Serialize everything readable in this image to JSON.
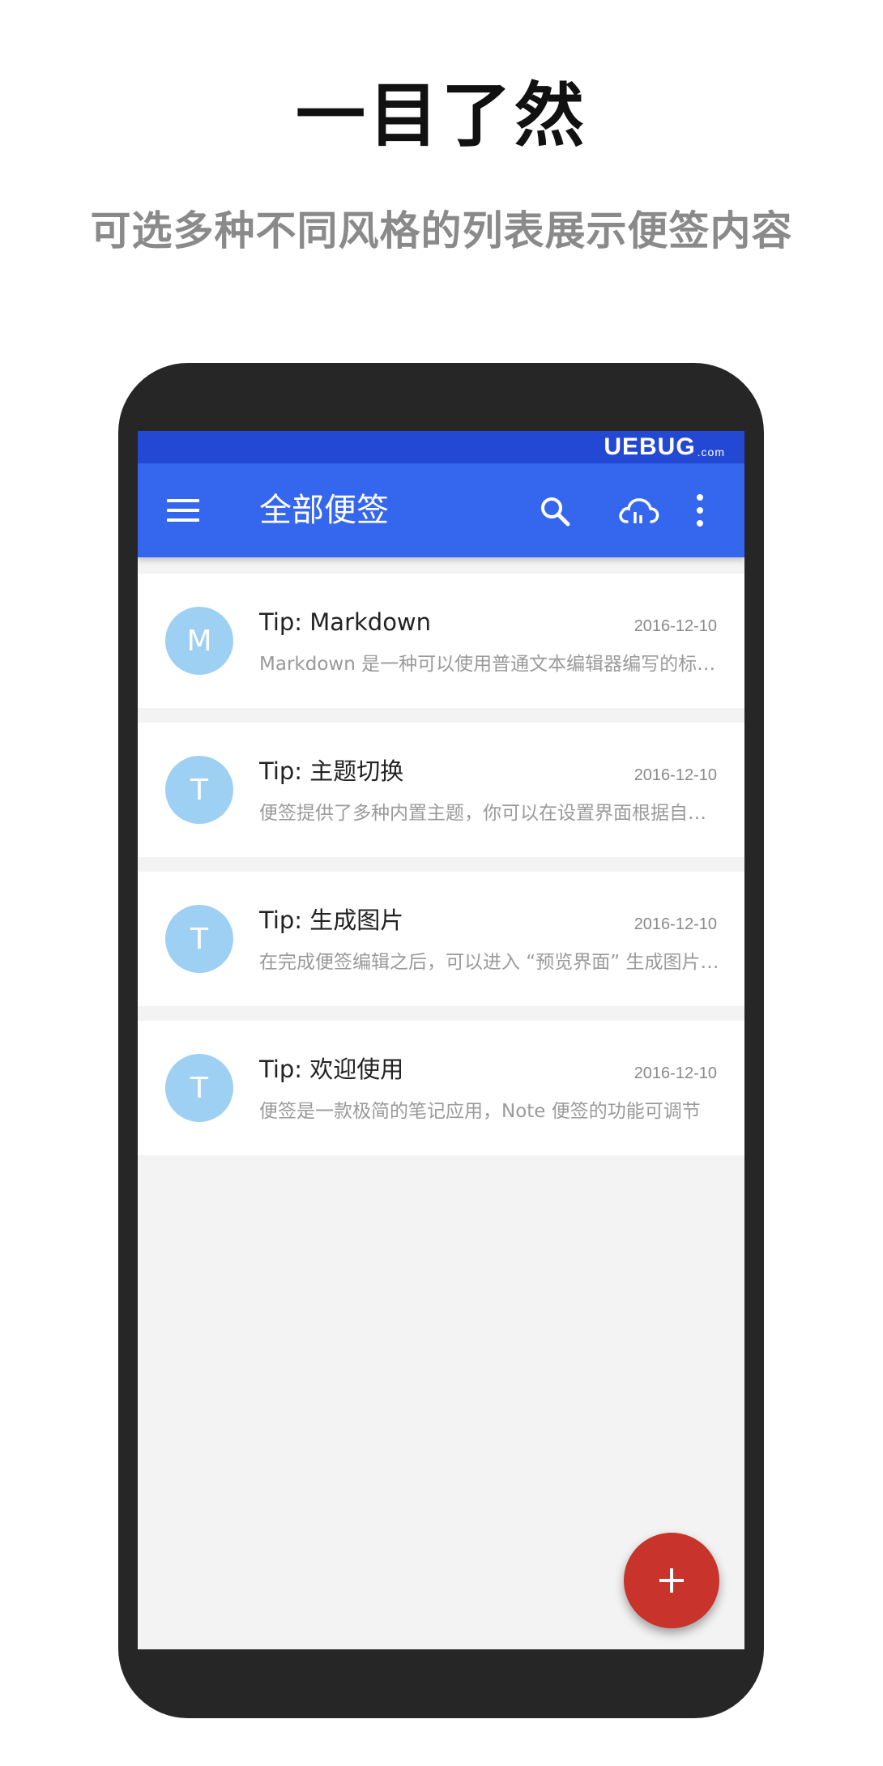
{
  "promo": {
    "headline": "一目了然",
    "subline": "可选多种不同风格的列表展示便签内容"
  },
  "status_bar": {
    "watermark": "UEBUG",
    "watermark_domain": ".com"
  },
  "app_bar": {
    "title": "全部便签",
    "menu_icon": "menu-icon",
    "search_icon": "search-icon",
    "sync_icon": "cloud-sync-icon",
    "more_icon": "more-vert-icon",
    "background": "#3566ee"
  },
  "notes": [
    {
      "avatar_letter": "M",
      "title": "Tip: Markdown",
      "date": "2016-12-10",
      "preview": "Markdown 是一种可以使用普通文本编辑器编写的标记语言"
    },
    {
      "avatar_letter": "T",
      "title": "Tip: 主题切换",
      "date": "2016-12-10",
      "preview": "便签提供了多种内置主题，你可以在设置界面根据自己的喜好"
    },
    {
      "avatar_letter": "T",
      "title": "Tip: 生成图片",
      "date": "2016-12-10",
      "preview": "在完成便签编辑之后，可以进入 “预览界面” 生成图片分享"
    },
    {
      "avatar_letter": "T",
      "title": "Tip: 欢迎使用",
      "date": "2016-12-10",
      "preview": "便签是一款极简的笔记应用，Note 便签的功能可调节"
    }
  ],
  "fab": {
    "icon": "plus-icon",
    "color": "#c8332b"
  }
}
